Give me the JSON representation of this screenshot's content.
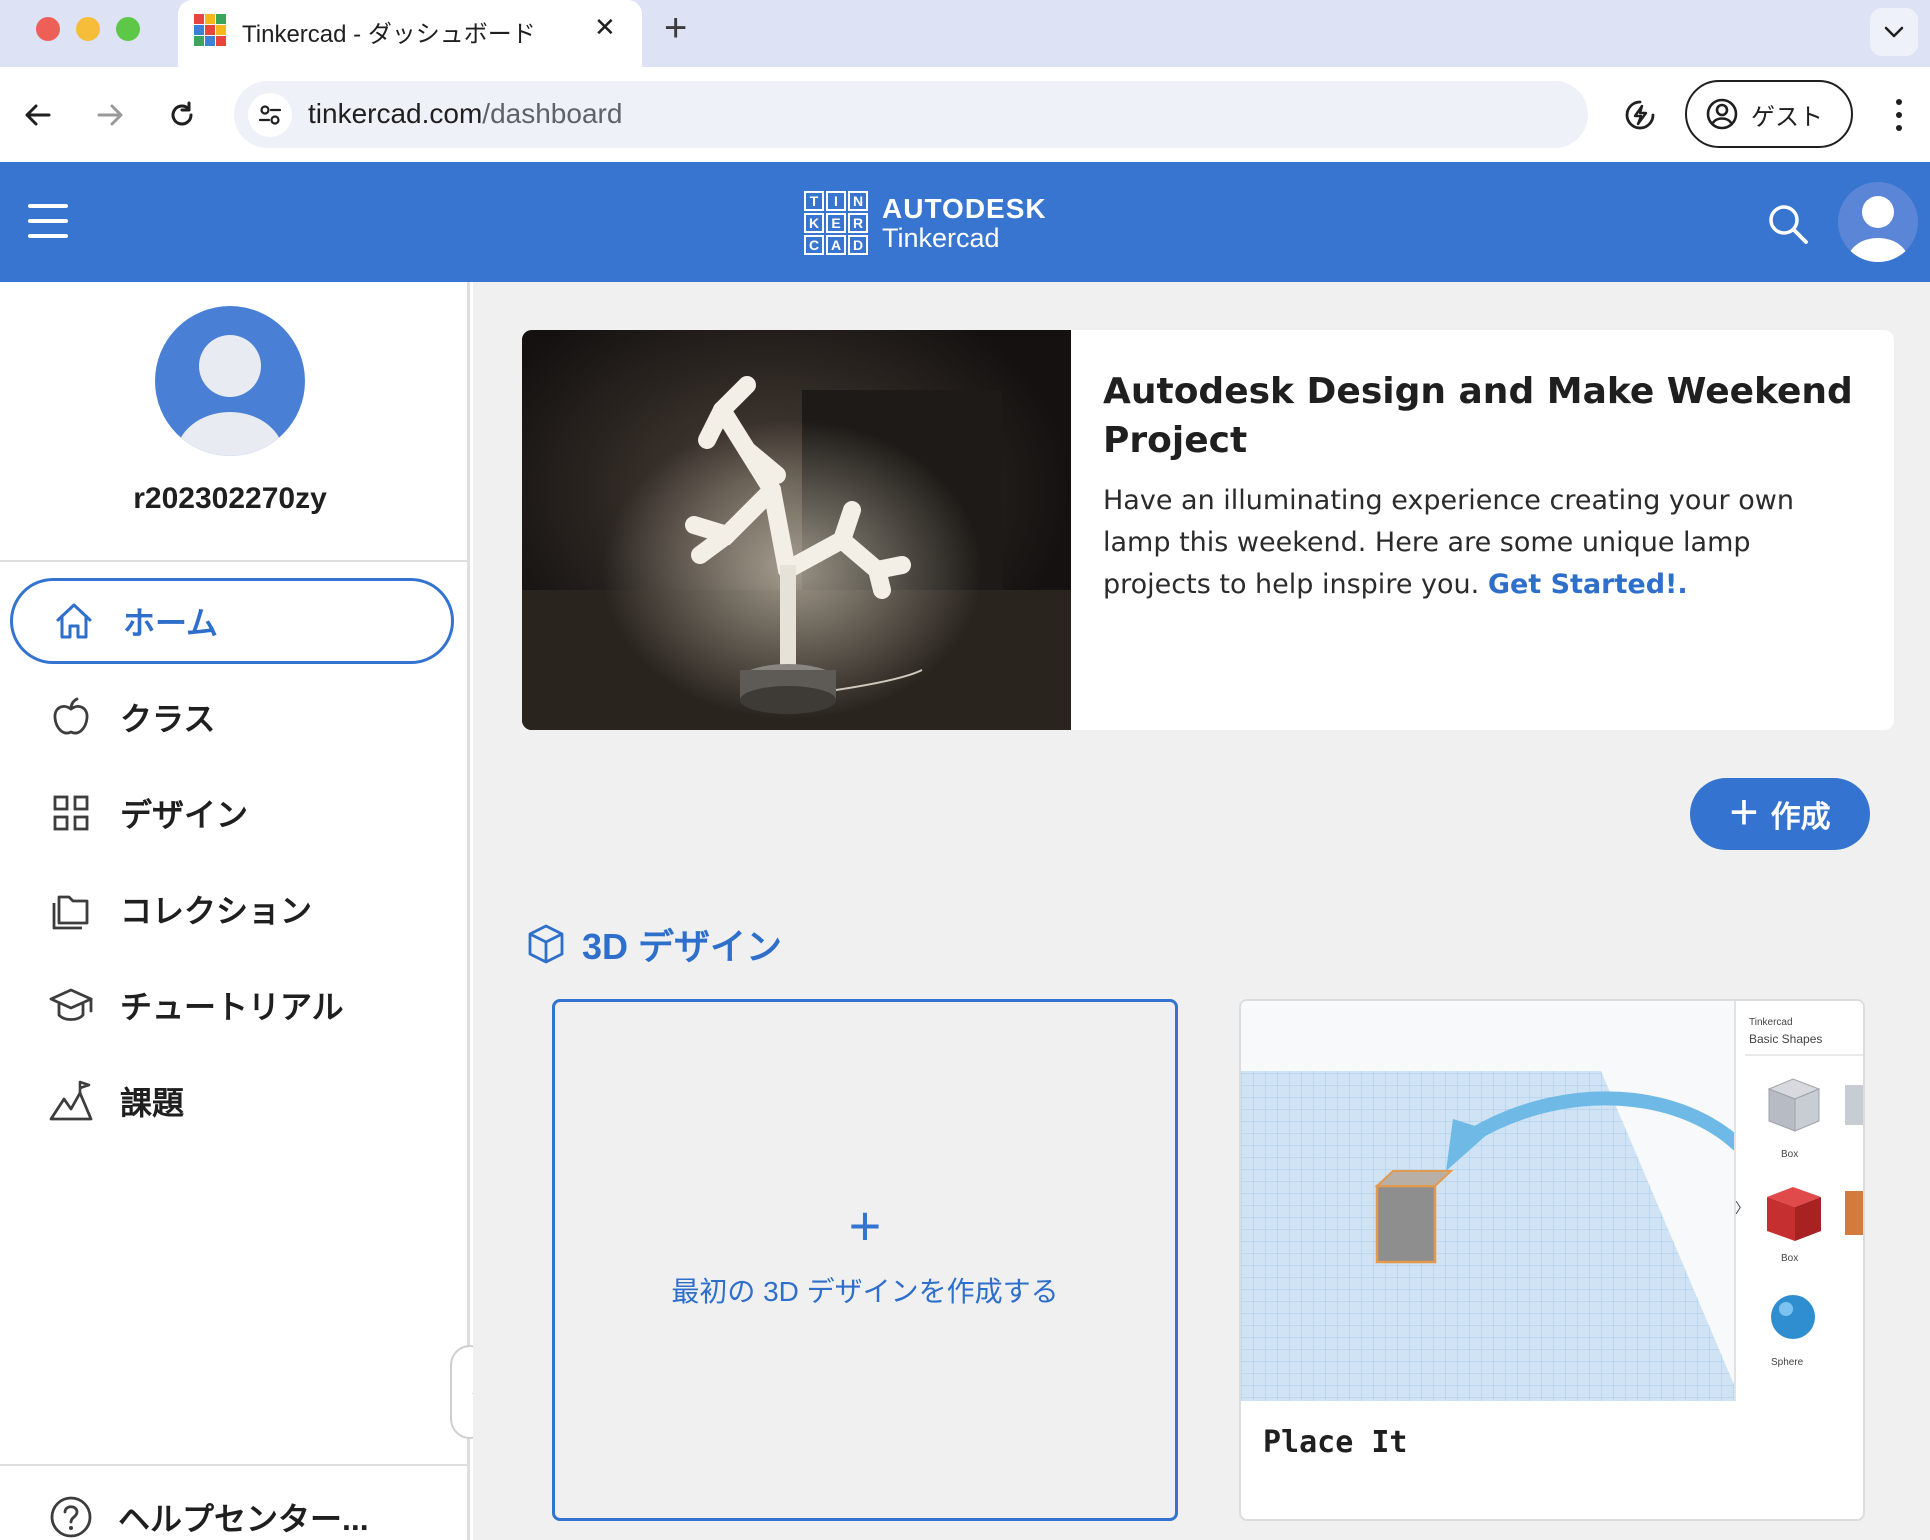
{
  "browser": {
    "tab_title": "Tinkercad - ダッシュボード",
    "url_domain": "tinkercad.com",
    "url_path": "/dashboard",
    "profile_label": "ゲスト"
  },
  "header": {
    "logo_letters": [
      "T",
      "I",
      "N",
      "K",
      "E",
      "R",
      "C",
      "A",
      "D"
    ],
    "brand": "AUTODESK",
    "product": "Tinkercad",
    "brand_color": "#3875d0"
  },
  "sidebar": {
    "username": "r202302270zy",
    "items": [
      {
        "label": "ホーム",
        "icon": "home-icon",
        "active": true
      },
      {
        "label": "クラス",
        "icon": "apple-icon",
        "active": false
      },
      {
        "label": "デザイン",
        "icon": "grid-icon",
        "active": false
      },
      {
        "label": "コレクション",
        "icon": "folders-icon",
        "active": false
      },
      {
        "label": "チュートリアル",
        "icon": "graduation-cap-icon",
        "active": false
      },
      {
        "label": "課題",
        "icon": "mountain-flag-icon",
        "active": false
      }
    ],
    "help_label": "ヘルプセンター..."
  },
  "banner": {
    "title": "Autodesk Design and Make Weekend Project",
    "description": "Have an illuminating experience creating your own lamp this weekend. Here are some unique lamp projects to help inspire you.",
    "link_label": "Get Started!."
  },
  "actions": {
    "create_label": "作成"
  },
  "designs": {
    "section_title": "3D デザイン",
    "new_design_label": "最初の 3D デザインを作成する",
    "tutorial": {
      "title": "Place It",
      "panel_app": "Tinkercad",
      "panel_heading": "Basic Shapes",
      "shapes": [
        "Box",
        "Box",
        "Sphere"
      ]
    }
  }
}
